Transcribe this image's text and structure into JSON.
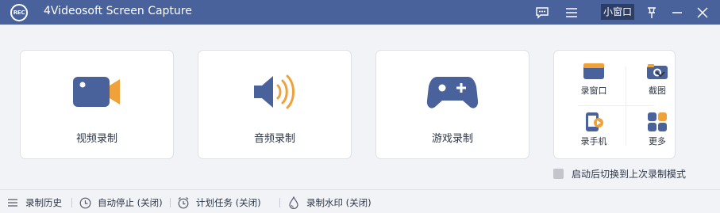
{
  "titlebar": {
    "logo_text": "REC",
    "app_title": "4Videosoft Screen Capture",
    "mini_window_label": "小窗口",
    "background_color": "#4a629b"
  },
  "cards": [
    {
      "label": "视频录制",
      "icon": "video-camera-icon"
    },
    {
      "label": "音频录制",
      "icon": "speaker-icon"
    },
    {
      "label": "游戏录制",
      "icon": "gamepad-icon"
    }
  ],
  "tools": [
    {
      "label": "录窗口",
      "icon": "window-icon"
    },
    {
      "label": "截图",
      "icon": "camera-icon"
    },
    {
      "label": "录手机",
      "icon": "phone-record-icon"
    },
    {
      "label": "更多",
      "icon": "grid-icon"
    }
  ],
  "switch_option": {
    "label": "启动后切换到上次录制模式",
    "checked": false
  },
  "bottombar": [
    {
      "label": "录制历史",
      "icon": "list-icon"
    },
    {
      "label": "自动停止 (关闭)",
      "icon": "clock-icon"
    },
    {
      "label": "计划任务 (关闭)",
      "icon": "alarm-clock-icon"
    },
    {
      "label": "录制水印 (关闭)",
      "icon": "water-drop-icon"
    }
  ],
  "colors": {
    "accent_blue": "#4a629b",
    "accent_orange": "#f0a23a"
  }
}
